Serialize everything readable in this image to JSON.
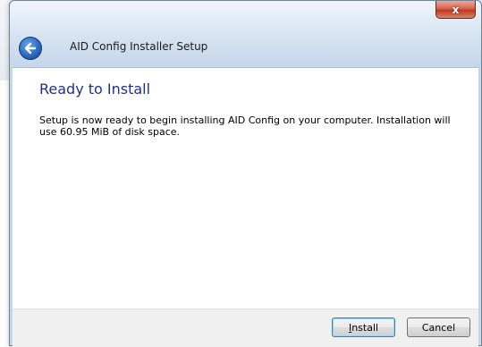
{
  "window": {
    "title": "AID Config Installer Setup",
    "close_symbol": "x"
  },
  "page": {
    "heading": "Ready to Install",
    "message": "Setup is now ready to begin installing AID Config on your computer. Installation will use 60.95 MiB of disk space."
  },
  "buttons": {
    "install_label": "Install",
    "cancel_label": "Cancel"
  },
  "colors": {
    "heading": "#1e3287",
    "frame": "#c3d6ea",
    "close": "#c0371f"
  }
}
